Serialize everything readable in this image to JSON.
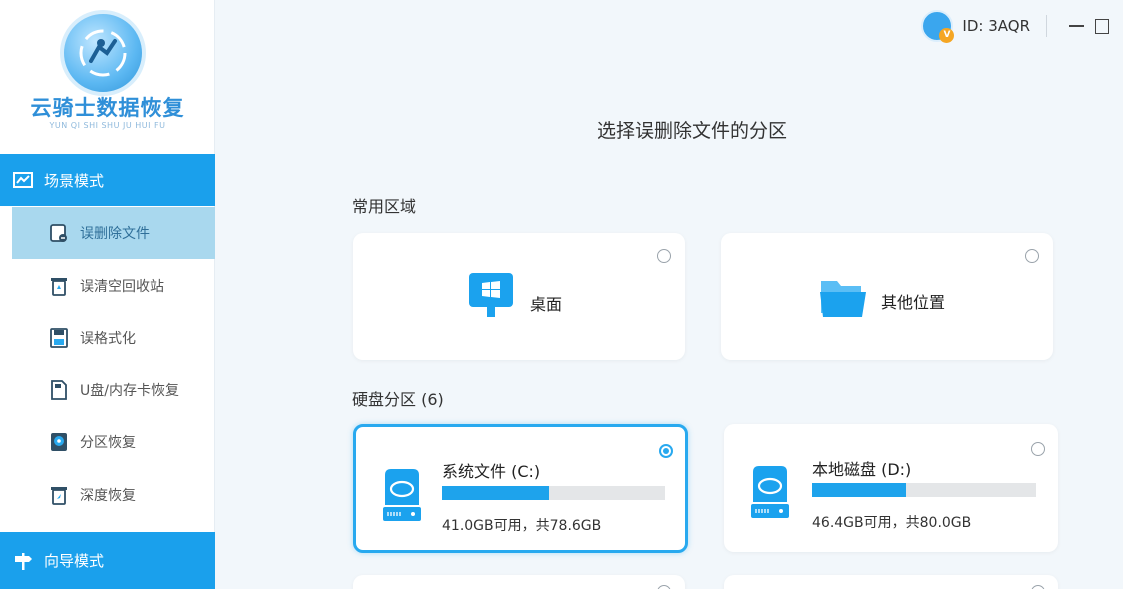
{
  "app": {
    "brand": "云骑士数据恢复",
    "brand_sub": "YUN QI SHI SHU JU HUI FU"
  },
  "topbar": {
    "user_id": "ID: 3AQR",
    "vip_badge": "V"
  },
  "sidebar": {
    "scene_mode": "场景模式",
    "guide_mode": "向导模式",
    "items": [
      {
        "label": "误删除文件",
        "icon": "deleted-file-icon",
        "active": true
      },
      {
        "label": "误清空回收站",
        "icon": "recycle-bin-icon",
        "active": false
      },
      {
        "label": "误格式化",
        "icon": "format-icon",
        "active": false
      },
      {
        "label": "U盘/内存卡恢复",
        "icon": "usb-card-icon",
        "active": false
      },
      {
        "label": "分区恢复",
        "icon": "partition-icon",
        "active": false
      },
      {
        "label": "深度恢复",
        "icon": "deep-recovery-icon",
        "active": false
      }
    ]
  },
  "main": {
    "title": "选择误删除文件的分区",
    "common_section": "常用区域",
    "common": [
      {
        "label": "桌面",
        "icon": "desktop-icon"
      },
      {
        "label": "其他位置",
        "icon": "folder-icon"
      }
    ],
    "disk_section": "硬盘分区 (6)",
    "disks": [
      {
        "name": "系统文件 (C:)",
        "size": "41.0GB可用，共78.6GB",
        "used_fraction": 0.48,
        "selected": true
      },
      {
        "name": "本地磁盘 (D:)",
        "size": "46.4GB可用，共80.0GB",
        "used_fraction": 0.42,
        "selected": false
      }
    ]
  },
  "colors": {
    "accent": "#1aa0ec",
    "active_item_bg": "#a9d8ee",
    "page_bg": "#f2f7fb"
  }
}
